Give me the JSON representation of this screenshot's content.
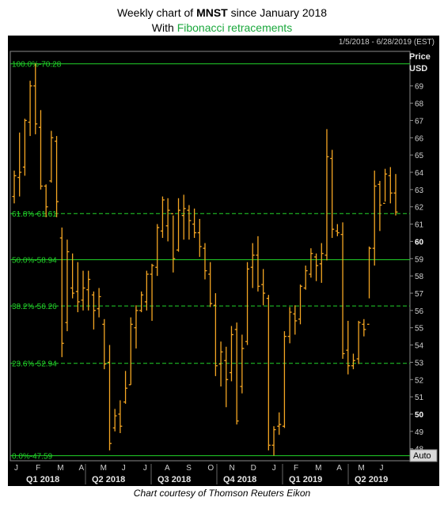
{
  "title": {
    "prefix": "Weekly chart of ",
    "ticker": "MNST",
    "suffix": " since January 2018",
    "line2_prefix": "With ",
    "line2_highlight": "Fibonacci retracements"
  },
  "range_label": "1/5/2018 - 6/28/2019 (EST)",
  "caption": "Chart courtesy of Thomson Reuters Eikon",
  "auto_label": "Auto",
  "colors": {
    "bars": "#f5a623",
    "fib": "#22d42a",
    "axis_text": "#d0d0d0",
    "grid": "#2a2a2a",
    "panel": "#000000",
    "fib_title": "#1aa83c"
  },
  "chart_data": {
    "type": "bar",
    "subtype": "ohlc",
    "xlabel": "",
    "ylabel": "Price USD",
    "y_axis_title": [
      "Price",
      "USD"
    ],
    "ylim": [
      47.3,
      71.0
    ],
    "y_ticks": [
      48,
      49,
      50,
      51,
      52,
      53,
      54,
      55,
      56,
      57,
      58,
      59,
      60,
      61,
      62,
      63,
      64,
      65,
      66,
      67,
      68,
      69
    ],
    "x_month_labels": [
      "J",
      "F",
      "M",
      "A",
      "M",
      "J",
      "J",
      "A",
      "S",
      "O",
      "N",
      "D",
      "J",
      "F",
      "M",
      "A",
      "M",
      "J"
    ],
    "x_quarter_labels": [
      "Q1 2018",
      "Q2 2018",
      "Q3 2018",
      "Q4 2018",
      "Q1 2019",
      "Q2 2019"
    ],
    "fibonacci_levels": [
      {
        "label": "100.0%-70.28",
        "value": 70.28,
        "style": "solid"
      },
      {
        "label": "61.8%-61.61",
        "value": 61.61,
        "style": "dashed"
      },
      {
        "label": "50.0%-58.94",
        "value": 58.94,
        "style": "solid"
      },
      {
        "label": "38.2%-56.26",
        "value": 56.26,
        "style": "dashed"
      },
      {
        "label": "23.6%-52.94",
        "value": 52.94,
        "style": "dashed"
      },
      {
        "label": "0.0%-47.59",
        "value": 47.59,
        "style": "solid"
      }
    ],
    "series": [
      {
        "columns": [
          "high",
          "low",
          "open",
          "close"
        ],
        "values": [
          [
            64.1,
            62.2,
            62.6,
            63.8
          ],
          [
            66.3,
            62.6,
            63.7,
            64.0
          ],
          [
            67.1,
            63.8,
            64.3,
            67.0
          ],
          [
            69.3,
            66.1,
            66.9,
            69.0
          ],
          [
            70.3,
            66.2,
            69.0,
            66.8
          ],
          [
            67.6,
            63.0,
            66.6,
            63.2
          ],
          [
            63.3,
            61.4,
            63.2,
            62.0
          ],
          [
            66.4,
            63.4,
            63.5,
            66.0
          ],
          [
            66.1,
            61.4,
            65.8,
            62.3
          ],
          [
            60.8,
            53.3,
            60.2,
            54.1
          ],
          [
            60.1,
            54.8,
            55.3,
            59.4
          ],
          [
            59.3,
            56.7,
            57.3,
            57.0
          ],
          [
            58.8,
            55.9,
            57.1,
            56.5
          ],
          [
            58.3,
            56.0,
            56.6,
            57.3
          ],
          [
            58.3,
            56.0,
            57.2,
            57.8
          ],
          [
            57.1,
            54.9,
            56.9,
            56.0
          ],
          [
            57.3,
            55.6,
            56.1,
            56.8
          ],
          [
            55.5,
            52.6,
            55.2,
            52.9
          ],
          [
            54.0,
            47.9,
            53.0,
            48.3
          ],
          [
            50.3,
            49.0,
            49.2,
            49.9
          ],
          [
            50.8,
            48.9,
            50.0,
            49.3
          ],
          [
            52.5,
            50.6,
            50.7,
            51.5
          ],
          [
            55.6,
            51.7,
            51.7,
            55.2
          ],
          [
            56.3,
            53.8,
            55.0,
            56.0
          ],
          [
            57.1,
            55.9,
            56.0,
            56.9
          ],
          [
            58.3,
            56.0,
            56.5,
            58.1
          ],
          [
            58.7,
            55.4,
            58.1,
            58.6
          ],
          [
            61.0,
            58.0,
            58.5,
            60.8
          ],
          [
            62.6,
            60.2,
            60.6,
            62.4
          ],
          [
            62.5,
            60.0,
            60.9,
            61.8
          ],
          [
            61.5,
            58.2,
            61.6,
            59.0
          ],
          [
            62.5,
            59.4,
            59.5,
            61.8
          ],
          [
            62.7,
            60.1,
            61.5,
            61.9
          ],
          [
            62.1,
            60.1,
            61.8,
            61.2
          ],
          [
            61.9,
            60.2,
            61.0,
            60.5
          ],
          [
            61.3,
            59.1,
            60.5,
            59.7
          ],
          [
            59.9,
            57.8,
            59.6,
            58.3
          ],
          [
            58.8,
            56.2,
            58.1,
            56.4
          ],
          [
            57.0,
            52.2,
            56.3,
            52.8
          ],
          [
            54.2,
            51.6,
            52.9,
            53.6
          ],
          [
            53.9,
            50.4,
            53.1,
            52.0
          ],
          [
            55.1,
            51.9,
            52.4,
            54.6
          ],
          [
            55.3,
            49.4,
            54.9,
            49.6
          ],
          [
            54.6,
            51.2,
            51.6,
            53.8
          ],
          [
            58.8,
            54.0,
            54.2,
            58.4
          ],
          [
            59.9,
            57.3,
            58.5,
            59.2
          ],
          [
            60.3,
            57.1,
            59.2,
            57.4
          ],
          [
            58.4,
            56.3,
            57.5,
            57.0
          ],
          [
            56.9,
            47.9,
            56.7,
            48.2
          ],
          [
            49.3,
            47.6,
            48.2,
            49.1
          ],
          [
            50.1,
            48.8,
            49.3,
            49.4
          ],
          [
            54.8,
            49.2,
            49.3,
            54.5
          ],
          [
            56.2,
            54.1,
            54.5,
            55.9
          ],
          [
            56.3,
            54.6,
            55.8,
            55.4
          ],
          [
            57.5,
            55.2,
            55.5,
            57.4
          ],
          [
            58.6,
            57.2,
            57.3,
            58.3
          ],
          [
            59.6,
            57.9,
            58.1,
            59.3
          ],
          [
            59.3,
            57.7,
            59.1,
            58.6
          ],
          [
            59.9,
            57.6,
            58.7,
            59.3
          ],
          [
            66.5,
            58.9,
            59.2,
            64.9
          ],
          [
            65.3,
            60.2,
            64.8,
            60.7
          ],
          [
            61.0,
            60.3,
            60.6,
            60.5
          ],
          [
            61.1,
            53.2,
            60.4,
            53.5
          ],
          [
            55.4,
            52.3,
            53.7,
            52.8
          ],
          [
            53.5,
            52.6,
            52.8,
            53.1
          ],
          [
            55.4,
            52.9,
            53.2,
            55.3
          ],
          [
            55.5,
            54.5,
            55.2,
            54.9
          ],
          [
            59.7,
            56.7,
            55.2,
            59.6
          ],
          [
            64.1,
            58.6,
            59.6,
            63.2
          ],
          [
            63.5,
            60.6,
            63.3,
            62.1
          ],
          [
            64.2,
            62.3,
            62.2,
            63.9
          ],
          [
            64.3,
            62.2,
            63.8,
            62.8
          ],
          [
            63.9,
            61.5,
            62.8,
            61.7
          ]
        ]
      }
    ]
  }
}
